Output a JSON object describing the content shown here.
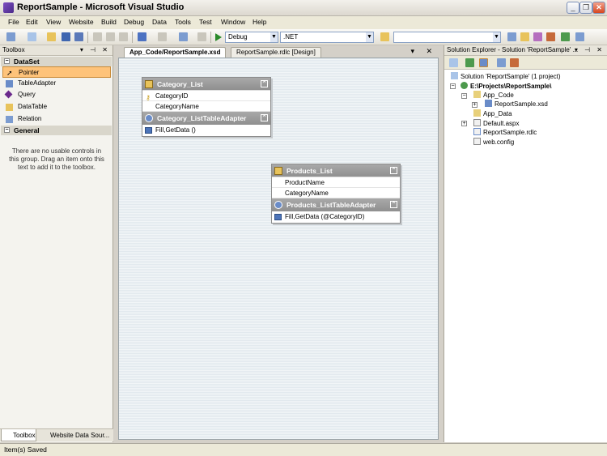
{
  "window": {
    "title": "ReportSample - Microsoft Visual Studio"
  },
  "menu": [
    "File",
    "Edit",
    "View",
    "Website",
    "Build",
    "Debug",
    "Data",
    "Tools",
    "Test",
    "Window",
    "Help"
  ],
  "toolbar": {
    "config": "Debug",
    "platform": ".NET",
    "find": ""
  },
  "toolbox": {
    "title": "Toolbox",
    "section_dataset": "DataSet",
    "items": [
      "Pointer",
      "TableAdapter",
      "Query",
      "DataTable",
      "Relation"
    ],
    "section_general": "General",
    "general_text": "There are no usable controls in this group. Drag an item onto this text to add it to the toolbox.",
    "tab_toolbox": "Toolbox",
    "tab_datasources": "Website Data Sour..."
  },
  "editor": {
    "tab_active": "App_Code/ReportSample.xsd",
    "tab_other": "ReportSample.rdlc [Design]"
  },
  "tables": [
    {
      "name": "Category_List",
      "columns": [
        "CategoryID",
        "CategoryName"
      ],
      "adapter": "Category_ListTableAdapter",
      "query": "Fill,GetData ()"
    },
    {
      "name": "Products_List",
      "columns": [
        "ProductName",
        "CategoryName"
      ],
      "adapter": "Products_ListTableAdapter",
      "query": "Fill,GetData (@CategoryID)"
    }
  ],
  "solution_explorer": {
    "title": "Solution Explorer - Solution 'ReportSample' ...",
    "solution": "Solution 'ReportSample' (1 project)",
    "project": "E:\\Projects\\ReportSample\\",
    "nodes": [
      "App_Code",
      "ReportSample.xsd",
      "App_Data",
      "Default.aspx",
      "ReportSample.rdlc",
      "web.config"
    ]
  },
  "status": "Item(s) Saved",
  "colors": {
    "selected": "#fec37a",
    "header": "#8f8f8f",
    "canvas": "#f1f5f7"
  }
}
